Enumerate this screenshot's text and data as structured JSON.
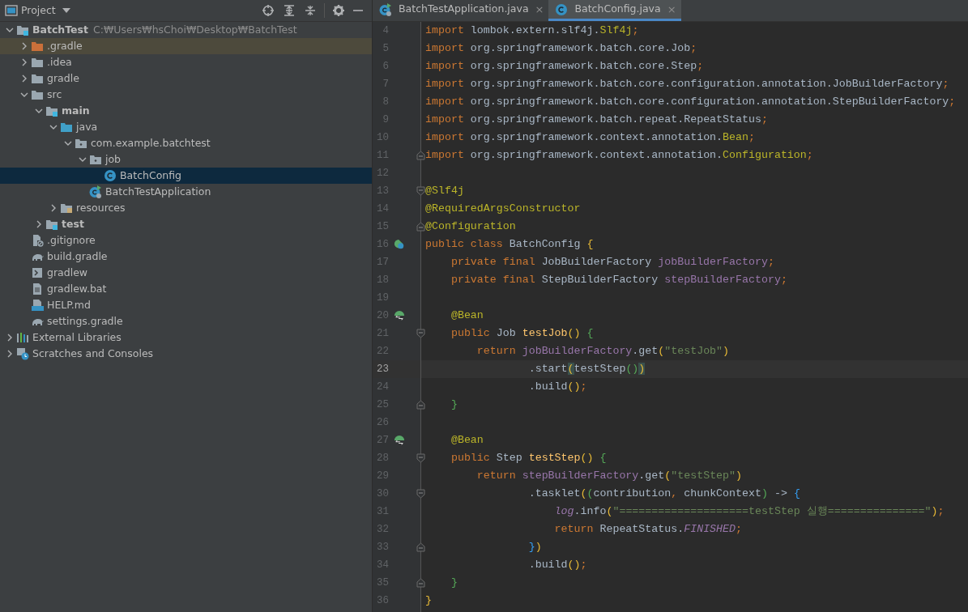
{
  "project_panel": {
    "title": "Project",
    "toolbar": [
      {
        "kind": "locate"
      },
      {
        "kind": "expand-all"
      },
      {
        "kind": "collapse-all"
      },
      {
        "kind": "settings"
      },
      {
        "kind": "hide"
      }
    ],
    "tree": [
      {
        "label": "BatchTest",
        "hint": "C:₩Users₩hsChoi₩Desktop₩BatchTest",
        "kind": "module",
        "bold": true,
        "expanded": true,
        "selected": false,
        "children": [
          {
            "label": ".gradle",
            "kind": "excluded-folder",
            "expanded": false,
            "tinted": true,
            "selected": false
          },
          {
            "label": ".idea",
            "kind": "folder",
            "expanded": false,
            "selected": false
          },
          {
            "label": "gradle",
            "kind": "folder",
            "expanded": false,
            "selected": false
          },
          {
            "label": "src",
            "kind": "folder",
            "expanded": true,
            "selected": false,
            "children": [
              {
                "label": "main",
                "kind": "module",
                "bold": true,
                "expanded": true,
                "selected": false,
                "children": [
                  {
                    "label": "java",
                    "kind": "source-folder",
                    "expanded": true,
                    "selected": false,
                    "children": [
                      {
                        "label": "com.example.batchtest",
                        "kind": "package",
                        "expanded": true,
                        "selected": false,
                        "children": [
                          {
                            "label": "job",
                            "kind": "package",
                            "expanded": true,
                            "selected": false,
                            "children": [
                              {
                                "label": "BatchConfig",
                                "kind": "class",
                                "selected": true
                              }
                            ]
                          },
                          {
                            "label": "BatchTestApplication",
                            "kind": "app",
                            "selected": false
                          }
                        ]
                      }
                    ]
                  },
                  {
                    "label": "resources",
                    "kind": "resources-folder",
                    "expanded": false,
                    "selected": false
                  }
                ]
              },
              {
                "label": "test",
                "kind": "module",
                "bold": true,
                "expanded": false,
                "selected": false
              }
            ]
          },
          {
            "label": ".gitignore",
            "kind": "ignore-file",
            "selected": false
          },
          {
            "label": "build.gradle",
            "kind": "gradle-file",
            "selected": false
          },
          {
            "label": "gradlew",
            "kind": "script-file",
            "selected": false
          },
          {
            "label": "gradlew.bat",
            "kind": "text-file",
            "selected": false
          },
          {
            "label": "HELP.md",
            "kind": "markdown-file",
            "selected": false
          },
          {
            "label": "settings.gradle",
            "kind": "gradle-file",
            "selected": false
          }
        ]
      },
      {
        "label": "External Libraries",
        "kind": "libraries",
        "expanded": false,
        "selected": false
      },
      {
        "label": "Scratches and Consoles",
        "kind": "scratches",
        "expanded": false,
        "selected": false
      }
    ]
  },
  "editor": {
    "tabs": [
      {
        "label": "BatchTestApplication.java",
        "kind": "app",
        "close": "×",
        "selected": false
      },
      {
        "label": "BatchConfig.java",
        "kind": "class",
        "close": "×",
        "selected": true
      }
    ],
    "lines": [
      {
        "number": "4",
        "tokens": [
          {
            "kind": "kw",
            "text": "import"
          },
          {
            "kind": "plain",
            "text": " lombok.extern.slf4j."
          },
          {
            "kind": "ann",
            "text": "Slf4j"
          },
          {
            "kind": "sep",
            "text": ";"
          }
        ]
      },
      {
        "number": "5",
        "tokens": [
          {
            "kind": "kw",
            "text": "import"
          },
          {
            "kind": "plain",
            "text": " org.springframework.batch.core.Job"
          },
          {
            "kind": "sep",
            "text": ";"
          }
        ]
      },
      {
        "number": "6",
        "tokens": [
          {
            "kind": "kw",
            "text": "import"
          },
          {
            "kind": "plain",
            "text": " org.springframework.batch.core.Step"
          },
          {
            "kind": "sep",
            "text": ";"
          }
        ]
      },
      {
        "number": "7",
        "tokens": [
          {
            "kind": "kw",
            "text": "import"
          },
          {
            "kind": "plain",
            "text": " org.springframework.batch.core.configuration.annotation.JobBuilderFactory"
          },
          {
            "kind": "sep",
            "text": ";"
          }
        ]
      },
      {
        "number": "8",
        "tokens": [
          {
            "kind": "kw",
            "text": "import"
          },
          {
            "kind": "plain",
            "text": " org.springframework.batch.core.configuration.annotation.StepBuilderFactory"
          },
          {
            "kind": "sep",
            "text": ";"
          }
        ]
      },
      {
        "number": "9",
        "tokens": [
          {
            "kind": "kw",
            "text": "import"
          },
          {
            "kind": "plain",
            "text": " org.springframework.batch.repeat.RepeatStatus"
          },
          {
            "kind": "sep",
            "text": ";"
          }
        ]
      },
      {
        "number": "10",
        "tokens": [
          {
            "kind": "kw",
            "text": "import"
          },
          {
            "kind": "plain",
            "text": " org.springframework.context.annotation."
          },
          {
            "kind": "ann",
            "text": "Bean"
          },
          {
            "kind": "sep",
            "text": ";"
          }
        ]
      },
      {
        "number": "11",
        "fold": {
          "kind": "close"
        },
        "tokens": [
          {
            "kind": "kw",
            "text": "import"
          },
          {
            "kind": "plain",
            "text": " org.springframework.context.annotation."
          },
          {
            "kind": "ann",
            "text": "Configuration"
          },
          {
            "kind": "sep",
            "text": ";"
          }
        ]
      },
      {
        "number": "12"
      },
      {
        "number": "13",
        "fold": {
          "kind": "open"
        },
        "tokens": [
          {
            "kind": "ann",
            "text": "@Slf4j"
          }
        ]
      },
      {
        "number": "14",
        "tokens": [
          {
            "kind": "ann",
            "text": "@RequiredArgsConstructor"
          }
        ]
      },
      {
        "number": "15",
        "fold": {
          "kind": "close"
        },
        "tokens": [
          {
            "kind": "ann",
            "text": "@Configuration"
          }
        ]
      },
      {
        "number": "16",
        "gutter_icon": {
          "kind": "bean-class"
        },
        "tokens": [
          {
            "kind": "kw",
            "text": "public class"
          },
          {
            "kind": "plain",
            "text": " BatchConfig "
          },
          {
            "kind": "gold",
            "text": "{"
          }
        ]
      },
      {
        "number": "17",
        "tokens": [
          {
            "kind": "kw",
            "text": "    private final"
          },
          {
            "kind": "plain",
            "text": " JobBuilderFactory "
          },
          {
            "kind": "field",
            "text": "jobBuilderFactory"
          },
          {
            "kind": "sep",
            "text": ";"
          }
        ]
      },
      {
        "number": "18",
        "tokens": [
          {
            "kind": "kw",
            "text": "    private final"
          },
          {
            "kind": "plain",
            "text": " StepBuilderFactory "
          },
          {
            "kind": "field",
            "text": "stepBuilderFactory"
          },
          {
            "kind": "sep",
            "text": ";"
          }
        ]
      },
      {
        "number": "19"
      },
      {
        "number": "20",
        "gutter_icon": {
          "kind": "bean-method"
        },
        "tokens": [
          {
            "kind": "ann",
            "text": "    @Bean"
          }
        ]
      },
      {
        "number": "21",
        "fold": {
          "kind": "open"
        },
        "tokens": [
          {
            "kind": "kw",
            "text": "    public"
          },
          {
            "kind": "plain",
            "text": " Job "
          },
          {
            "kind": "method",
            "text": "testJob"
          },
          {
            "kind": "gold",
            "text": "()"
          },
          {
            "kind": "green",
            "text": " {"
          }
        ]
      },
      {
        "number": "22",
        "tokens": [
          {
            "kind": "kw",
            "text": "        return "
          },
          {
            "kind": "field",
            "text": "jobBuilderFactory"
          },
          {
            "kind": "plain",
            "text": ".get"
          },
          {
            "kind": "gold",
            "text": "("
          },
          {
            "kind": "str",
            "text": "\"testJob\""
          },
          {
            "kind": "gold",
            "text": ")"
          }
        ]
      },
      {
        "number": "23",
        "current": true,
        "tokens": [
          {
            "kind": "plain",
            "text": "                .start"
          },
          {
            "kind": "match",
            "text": "("
          },
          {
            "kind": "plain",
            "text": "testStep"
          },
          {
            "kind": "green",
            "text": "()"
          },
          {
            "kind": "match",
            "text": ")"
          }
        ]
      },
      {
        "number": "24",
        "tokens": [
          {
            "kind": "plain",
            "text": "                .build"
          },
          {
            "kind": "gold",
            "text": "()"
          },
          {
            "kind": "sep",
            "text": ";"
          }
        ]
      },
      {
        "number": "25",
        "fold": {
          "kind": "close"
        },
        "tokens": [
          {
            "kind": "green",
            "text": "    }"
          }
        ]
      },
      {
        "number": "26"
      },
      {
        "number": "27",
        "gutter_icon": {
          "kind": "bean-method"
        },
        "tokens": [
          {
            "kind": "ann",
            "text": "    @Bean"
          }
        ]
      },
      {
        "number": "28",
        "fold": {
          "kind": "open"
        },
        "tokens": [
          {
            "kind": "kw",
            "text": "    public"
          },
          {
            "kind": "plain",
            "text": " Step "
          },
          {
            "kind": "method",
            "text": "testStep"
          },
          {
            "kind": "gold",
            "text": "()"
          },
          {
            "kind": "green",
            "text": " {"
          }
        ]
      },
      {
        "number": "29",
        "tokens": [
          {
            "kind": "kw",
            "text": "        return "
          },
          {
            "kind": "field",
            "text": "stepBuilderFactory"
          },
          {
            "kind": "plain",
            "text": ".get"
          },
          {
            "kind": "gold",
            "text": "("
          },
          {
            "kind": "str",
            "text": "\"testStep\""
          },
          {
            "kind": "gold",
            "text": ")"
          }
        ]
      },
      {
        "number": "30",
        "fold": {
          "kind": "open"
        },
        "tokens": [
          {
            "kind": "plain",
            "text": "                .tasklet"
          },
          {
            "kind": "gold",
            "text": "("
          },
          {
            "kind": "green",
            "text": "("
          },
          {
            "kind": "plain",
            "text": "contribution"
          },
          {
            "kind": "sep",
            "text": ","
          },
          {
            "kind": "plain",
            "text": " chunkContext"
          },
          {
            "kind": "green",
            "text": ")"
          },
          {
            "kind": "plain",
            "text": " -> "
          },
          {
            "kind": "blue",
            "text": "{"
          }
        ]
      },
      {
        "number": "31",
        "tokens": [
          {
            "kind": "const",
            "text": "                    log"
          },
          {
            "kind": "plain",
            "text": ".info"
          },
          {
            "kind": "gold",
            "text": "("
          },
          {
            "kind": "str",
            "text": "\"====================testStep 실행===============\""
          },
          {
            "kind": "gold",
            "text": ")"
          },
          {
            "kind": "sep",
            "text": ";"
          }
        ]
      },
      {
        "number": "32",
        "tokens": [
          {
            "kind": "kw",
            "text": "                    return"
          },
          {
            "kind": "plain",
            "text": " RepeatStatus."
          },
          {
            "kind": "const",
            "text": "FINISHED"
          },
          {
            "kind": "sep",
            "text": ";"
          }
        ]
      },
      {
        "number": "33",
        "fold": {
          "kind": "close"
        },
        "tokens": [
          {
            "kind": "blue",
            "text": "                }"
          },
          {
            "kind": "gold",
            "text": ")"
          }
        ]
      },
      {
        "number": "34",
        "tokens": [
          {
            "kind": "plain",
            "text": "                .build"
          },
          {
            "kind": "gold",
            "text": "()"
          },
          {
            "kind": "sep",
            "text": ";"
          }
        ]
      },
      {
        "number": "35",
        "fold": {
          "kind": "close"
        },
        "tokens": [
          {
            "kind": "green",
            "text": "    }"
          }
        ]
      },
      {
        "number": "36",
        "tokens": [
          {
            "kind": "gold",
            "text": "}"
          }
        ]
      }
    ]
  }
}
